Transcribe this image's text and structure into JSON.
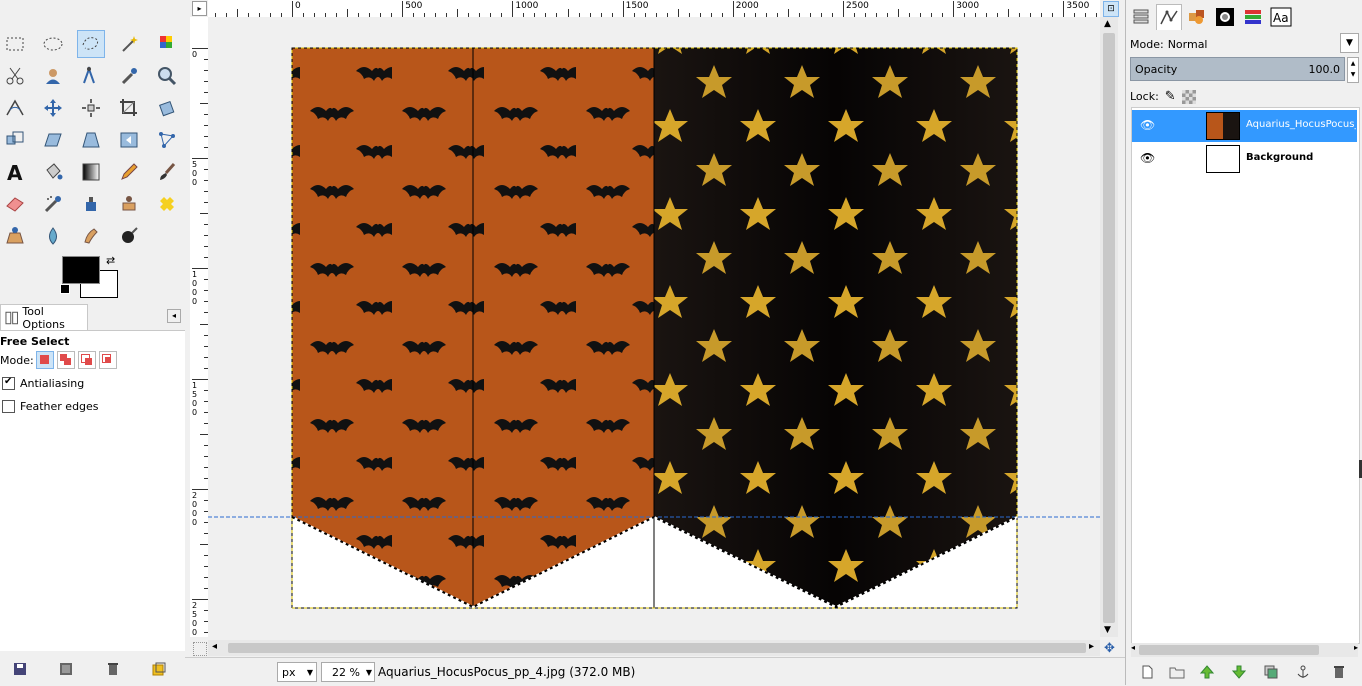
{
  "toolbox": {
    "tools": [
      "rect-select",
      "ellipse-select",
      "free-select",
      "fuzzy-select",
      "color-select",
      "scissors-select",
      "foreground-select",
      "paths",
      "color-picker",
      "zoom",
      "measure",
      "move",
      "align",
      "crop",
      "rotate",
      "scale",
      "shear",
      "perspective",
      "flip",
      "cage-transform",
      "text",
      "bucket-fill",
      "blend",
      "pencil",
      "paintbrush",
      "eraser",
      "airbrush",
      "ink",
      "clone",
      "heal",
      "perspective-clone",
      "blur-sharpen",
      "smudge",
      "dodge-burn"
    ],
    "active_tool": "free-select",
    "fg_color": "#000000",
    "bg_color": "#ffffff"
  },
  "tool_options": {
    "tab_label": "Tool Options",
    "title": "Free Select",
    "mode_label": "Mode:",
    "antialiasing_label": "Antialiasing",
    "antialiasing_checked": true,
    "feather_label": "Feather edges",
    "feather_checked": false
  },
  "ruler": {
    "h_labels": [
      "0",
      "500",
      "1000",
      "1500",
      "2000",
      "2500",
      "3000",
      "3500"
    ],
    "v_labels": [
      "0",
      "500",
      "1000",
      "1500",
      "2000",
      "2500"
    ]
  },
  "status": {
    "unit": "px",
    "zoom": "22 %",
    "filename": "Aquarius_HocusPocus_pp_4.jpg (372.0 MB)"
  },
  "layers_panel": {
    "mode_label": "Mode:",
    "mode_value": "Normal",
    "opacity_label": "Opacity",
    "opacity_value": "100.0",
    "lock_label": "Lock:",
    "layers": [
      {
        "name": "Aquarius_HocusPocus_pp",
        "selected": true
      },
      {
        "name": "Background",
        "selected": false
      }
    ]
  },
  "colors": {
    "orange": "#b8561a",
    "dark": "#1a1411",
    "star": "#d6a62a",
    "selection": "#3399ff"
  }
}
